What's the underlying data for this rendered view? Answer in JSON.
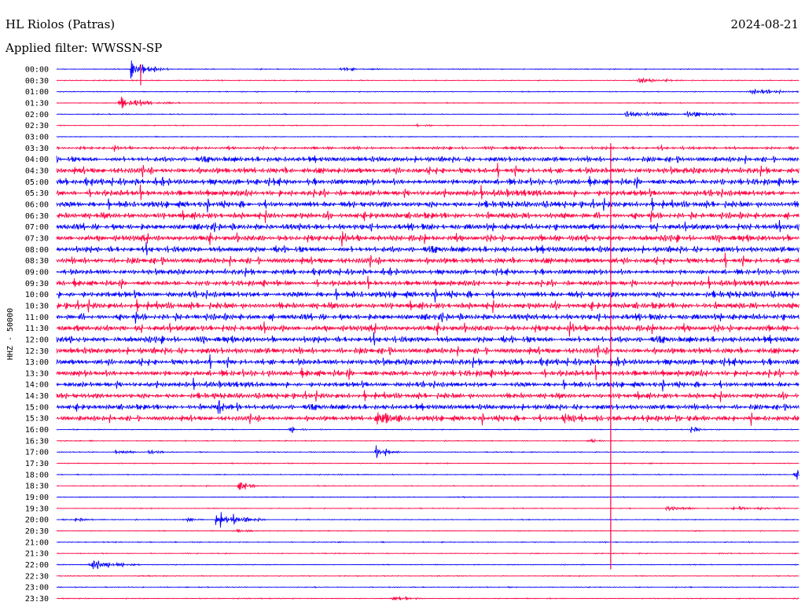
{
  "header": {
    "title": "HL Riolos (Patras)",
    "date": "2024-08-21",
    "filter": "Applied filter: WWSSN-SP"
  },
  "ylabel": "HHZ - 50000",
  "colors": {
    "odd": "#0000ff",
    "even": "#ff0040",
    "text": "#000000",
    "background": "#ffffff"
  },
  "chart_data": {
    "type": "line",
    "title": "HL Riolos (Patras)",
    "subtitle": "Applied filter: WWSSN-SP",
    "ylabel": "HHZ - 50000",
    "xlabel": "",
    "date": "2024-08-21",
    "row_labels": [
      "00:00",
      "00:30",
      "01:00",
      "01:30",
      "02:00",
      "02:30",
      "03:00",
      "03:30",
      "04:00",
      "04:30",
      "05:00",
      "05:30",
      "06:00",
      "06:30",
      "07:00",
      "07:30",
      "08:00",
      "08:30",
      "09:00",
      "09:30",
      "10:00",
      "10:30",
      "11:00",
      "11:30",
      "12:00",
      "12:30",
      "13:00",
      "13:30",
      "14:00",
      "14:30",
      "15:00",
      "15:30",
      "16:00",
      "16:30",
      "17:00",
      "17:30",
      "18:00",
      "18:30",
      "19:00",
      "19:30",
      "20:00",
      "20:30",
      "21:00",
      "21:30",
      "22:00",
      "22:30",
      "23:00",
      "23:30"
    ],
    "x_range": [
      0,
      30
    ],
    "x_unit": "minutes",
    "noise_level": [
      1,
      1,
      1,
      1,
      1,
      1,
      1,
      3,
      6,
      7,
      7,
      7,
      7,
      7,
      7,
      7,
      7,
      7,
      6,
      6,
      7,
      7,
      7,
      7,
      7,
      7,
      7,
      7,
      6,
      6,
      6,
      6,
      1,
      1,
      1,
      1,
      1,
      1,
      1,
      1,
      1,
      1,
      1,
      1,
      1,
      1,
      1,
      1
    ],
    "events": [
      {
        "row": 0,
        "x": 3.0,
        "amp": 20,
        "dur": 0.6
      },
      {
        "row": 0,
        "x": 11.5,
        "amp": 4,
        "dur": 0.8
      },
      {
        "row": 1,
        "x": 23.5,
        "amp": 6,
        "dur": 0.8
      },
      {
        "row": 2,
        "x": 28.0,
        "amp": 8,
        "dur": 0.8
      },
      {
        "row": 3,
        "x": 2.5,
        "amp": 14,
        "dur": 1.0
      },
      {
        "row": 4,
        "x": 23.0,
        "amp": 10,
        "dur": 1.2
      },
      {
        "row": 4,
        "x": 25.5,
        "amp": 6,
        "dur": 0.8
      },
      {
        "row": 5,
        "x": 14.5,
        "amp": 2,
        "dur": 0.6
      },
      {
        "row": 30,
        "x": 6.5,
        "amp": 14,
        "dur": 0.4
      },
      {
        "row": 31,
        "x": 12.9,
        "amp": 18,
        "dur": 0.4
      },
      {
        "row": 31,
        "x": 20.5,
        "amp": 16,
        "dur": 0.4
      },
      {
        "row": 31,
        "x": 26.2,
        "amp": 12,
        "dur": 0.4
      },
      {
        "row": 32,
        "x": 9.4,
        "amp": 10,
        "dur": 0.3
      },
      {
        "row": 32,
        "x": 25.6,
        "amp": 12,
        "dur": 0.3
      },
      {
        "row": 33,
        "x": 21.5,
        "amp": 8,
        "dur": 0.3
      },
      {
        "row": 34,
        "x": 2.4,
        "amp": 14,
        "dur": 0.3
      },
      {
        "row": 34,
        "x": 3.7,
        "amp": 10,
        "dur": 0.3
      },
      {
        "row": 34,
        "x": 12.9,
        "amp": 28,
        "dur": 0.4
      },
      {
        "row": 36,
        "x": 29.8,
        "amp": 22,
        "dur": 0.4
      },
      {
        "row": 37,
        "x": 7.3,
        "amp": 16,
        "dur": 0.4
      },
      {
        "row": 39,
        "x": 24.6,
        "amp": 8,
        "dur": 0.6
      },
      {
        "row": 39,
        "x": 27.3,
        "amp": 8,
        "dur": 0.8
      },
      {
        "row": 40,
        "x": 0.7,
        "amp": 10,
        "dur": 0.3
      },
      {
        "row": 40,
        "x": 5.2,
        "amp": 8,
        "dur": 0.3
      },
      {
        "row": 40,
        "x": 6.4,
        "amp": 22,
        "dur": 0.8
      },
      {
        "row": 41,
        "x": 7.2,
        "amp": 6,
        "dur": 0.4
      },
      {
        "row": 44,
        "x": 1.3,
        "amp": 18,
        "dur": 0.8
      },
      {
        "row": 47,
        "x": 13.5,
        "amp": 6,
        "dur": 0.6
      }
    ],
    "spikes": [
      {
        "x": 22.4,
        "from_row": 7,
        "to_row": 44
      },
      {
        "x": 3.4,
        "from_row": 0,
        "to_row": 1
      }
    ]
  }
}
